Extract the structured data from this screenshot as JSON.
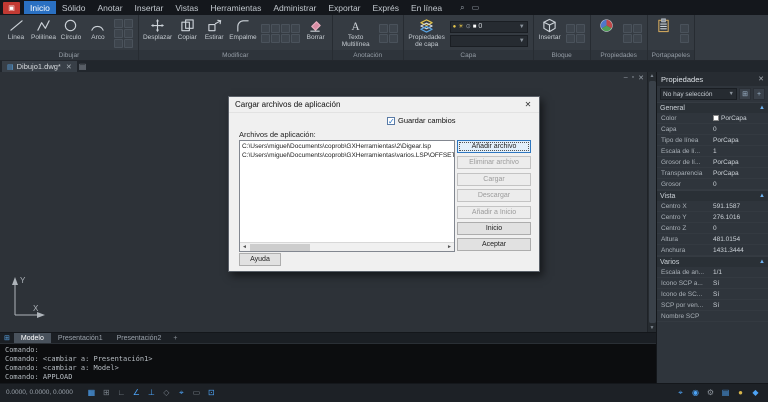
{
  "menubar": {
    "items": [
      "Inicio",
      "Sólido",
      "Anotar",
      "Insertar",
      "Vistas",
      "Herramientas",
      "Administrar",
      "Exportar",
      "Exprés",
      "En línea"
    ],
    "active": "Inicio",
    "quick_icons": [
      {
        "name": "search-icon",
        "glyph": "⌕"
      },
      {
        "name": "window-icon",
        "glyph": "▭"
      }
    ]
  },
  "ribbon": {
    "groups": [
      {
        "id": "dibujar",
        "label": "Dibujar",
        "items": [
          {
            "kind": "tool",
            "id": "linea",
            "label": "Línea",
            "icon": "line"
          },
          {
            "kind": "tool",
            "id": "polilinea",
            "label": "Polilínea",
            "icon": "polyline"
          },
          {
            "kind": "tool",
            "id": "circulo",
            "label": "Círculo",
            "icon": "circle"
          },
          {
            "kind": "tool",
            "id": "arco",
            "label": "Arco",
            "icon": "arc"
          },
          {
            "kind": "minis",
            "count": 6,
            "cols": 2
          }
        ]
      },
      {
        "id": "modificar",
        "label": "Modificar",
        "items": [
          {
            "kind": "tool",
            "id": "desplazar",
            "label": "Desplazar",
            "icon": "move"
          },
          {
            "kind": "tool",
            "id": "copiar",
            "label": "Copiar",
            "icon": "copy"
          },
          {
            "kind": "tool",
            "id": "estirar",
            "label": "Estirar",
            "icon": "stretch"
          },
          {
            "kind": "tool",
            "id": "empalme",
            "label": "Empalme",
            "icon": "fillet"
          },
          {
            "kind": "minis",
            "count": 8,
            "cols": 4
          },
          {
            "kind": "tool",
            "id": "borrar",
            "label": "Borrar",
            "icon": "erase"
          }
        ]
      },
      {
        "id": "anotacion",
        "label": "Anotación",
        "items": [
          {
            "kind": "tool",
            "id": "texto-multilinea",
            "label": "Texto Multilínea",
            "icon": "mtext"
          },
          {
            "kind": "minis",
            "count": 4,
            "cols": 2
          }
        ]
      },
      {
        "id": "capa",
        "label": "Capa",
        "items": [
          {
            "kind": "tool",
            "id": "propiedades-de-capa",
            "label": "Propiedades de capa",
            "icon": "layers"
          },
          {
            "kind": "layerbox"
          }
        ]
      },
      {
        "id": "bloque",
        "label": "Bloque",
        "items": [
          {
            "kind": "tool",
            "id": "insertar",
            "label": "Insertar",
            "icon": "insert"
          },
          {
            "kind": "minis",
            "count": 4,
            "cols": 2
          }
        ]
      },
      {
        "id": "propiedades",
        "label": "Propiedades",
        "items": [
          {
            "kind": "tool",
            "id": "propiedades-objeto",
            "label": "",
            "icon": "propwheel"
          },
          {
            "kind": "minis",
            "count": 4,
            "cols": 2
          }
        ]
      },
      {
        "id": "portapapeles",
        "label": "Portapapeles",
        "items": [
          {
            "kind": "tool",
            "id": "pegar",
            "label": "",
            "icon": "clipboard"
          },
          {
            "kind": "minis",
            "count": 2,
            "cols": 1
          }
        ]
      }
    ],
    "layerbox": {
      "selected_layer": "0",
      "layer_icons": [
        {
          "name": "bulb-icon",
          "glyph": "●",
          "color": "#e6c64c"
        },
        {
          "name": "sun-icon",
          "glyph": "☀",
          "color": "#e6c64c"
        },
        {
          "name": "lock-icon",
          "glyph": "⊙",
          "color": "#9aa2ab"
        },
        {
          "name": "layer-color-swatch",
          "glyph": "■",
          "color": "#ffffff"
        }
      ]
    }
  },
  "docbar": {
    "tab_label": "Dibujo1.dwg*",
    "tab_icon": "▤",
    "close_glyph": "✕",
    "new_tab_glyph": "▤"
  },
  "canvas": {
    "window_controls": [
      {
        "name": "minimize-icon",
        "glyph": "–"
      },
      {
        "name": "restore-icon",
        "glyph": "▫"
      },
      {
        "name": "close-icon",
        "glyph": "✕"
      }
    ],
    "ucs_x_label": "X",
    "ucs_y_label": "Y"
  },
  "dialog": {
    "title": "Cargar archivos de aplicación",
    "close_glyph": "✕",
    "save_changes_label": "Guardar cambios",
    "save_changes_checked": true,
    "files_label": "Archivos de aplicación:",
    "files": [
      "C:\\Users\\miguel\\Documents\\coprob\\GXHerramientas\\2\\Digear.lsp",
      "C:\\Users\\miguel\\Documents\\coprob\\GXHerramientas\\varios.LSP\\OFFSET.LSP"
    ],
    "buttons": [
      {
        "label": "Añadir archivo",
        "disabled": false,
        "focused": true
      },
      {
        "label": "Eliminar archivo",
        "disabled": true,
        "focused": false
      },
      {
        "label": "Cargar",
        "disabled": true,
        "focused": false
      },
      {
        "label": "Descargar",
        "disabled": true,
        "focused": false
      },
      {
        "label": "Añadir a Inicio",
        "disabled": true,
        "focused": false
      },
      {
        "label": "Inicio",
        "disabled": false,
        "focused": false
      },
      {
        "label": "Aceptar",
        "disabled": false,
        "focused": false
      }
    ],
    "help_label": "Ayuda"
  },
  "properties": {
    "title": "Propiedades",
    "close_glyph": "✕",
    "selection": "No hay selección",
    "tool_icons": [
      {
        "name": "toggle-value-icon",
        "glyph": "⊞"
      },
      {
        "name": "quick-select-icon",
        "glyph": "+"
      }
    ],
    "sections": [
      {
        "name": "General",
        "rows": [
          {
            "label": "Color",
            "value": "PorCapa",
            "swatch": "#ffffff"
          },
          {
            "label": "Capa",
            "value": "0"
          },
          {
            "label": "Tipo de línea",
            "value": "PorCapa"
          },
          {
            "label": "Escala de lí...",
            "value": "1"
          },
          {
            "label": "Grosor de lí...",
            "value": "PorCapa"
          },
          {
            "label": "Transparencia",
            "value": "PorCapa"
          },
          {
            "label": "Grosor",
            "value": "0"
          }
        ]
      },
      {
        "name": "Vista",
        "rows": [
          {
            "label": "Centro X",
            "value": "591.1587"
          },
          {
            "label": "Centro Y",
            "value": "276.1016"
          },
          {
            "label": "Centro Z",
            "value": "0"
          },
          {
            "label": "Altura",
            "value": "481.0154"
          },
          {
            "label": "Anchura",
            "value": "1431.3444"
          }
        ]
      },
      {
        "name": "Varios",
        "rows": [
          {
            "label": "Escala de an...",
            "value": "1/1"
          },
          {
            "label": "Icono SCP a...",
            "value": "Sí"
          },
          {
            "label": "Icono de SC...",
            "value": "Sí"
          },
          {
            "label": "SCP por ven...",
            "value": "Sí"
          },
          {
            "label": "Nombre SCP",
            "value": ""
          }
        ]
      }
    ]
  },
  "layouts": {
    "tabs": [
      "Modelo",
      "Presentación1",
      "Presentación2"
    ],
    "active": "Modelo",
    "grid_icon": "⊞",
    "plus_glyph": "+"
  },
  "command": {
    "lines": [
      "Comando:",
      "Comando: <cambiar a: Presentación1>",
      "Comando: <cambiar a: Model>",
      "Comando: APPLOAD"
    ]
  },
  "statusbar": {
    "coords": "0.0000, 0.0000, 0.0000",
    "left_icons": [
      {
        "name": "grid-icon",
        "glyph": "▦",
        "on": true
      },
      {
        "name": "snap-icon",
        "glyph": "⊞",
        "on": false
      },
      {
        "name": "ortho-icon",
        "glyph": "∟",
        "on": false
      },
      {
        "name": "polar-icon",
        "glyph": "∠",
        "on": true
      },
      {
        "name": "osnap-icon",
        "glyph": "⊥",
        "on": true
      },
      {
        "name": "otrack-icon",
        "glyph": "◇",
        "on": false
      },
      {
        "name": "dyn-input-icon",
        "glyph": "⌖",
        "on": true
      },
      {
        "name": "lineweight-icon",
        "glyph": "▭",
        "on": false
      },
      {
        "name": "transparency-icon",
        "glyph": "⊡",
        "on": true
      }
    ],
    "right_icons": [
      {
        "name": "annotation-scale-icon",
        "glyph": "⌖",
        "color": "#4da3f5"
      },
      {
        "name": "workspace-icon",
        "glyph": "◉",
        "color": "#4da3f5"
      },
      {
        "name": "settings-gear-icon",
        "glyph": "⚙",
        "color": "#8b929a"
      },
      {
        "name": "viewport-icon",
        "glyph": "▤",
        "color": "#4da3f5"
      },
      {
        "name": "isolate-objects-icon",
        "glyph": "●",
        "color": "#d8b54a"
      },
      {
        "name": "clean-screen-icon",
        "glyph": "◆",
        "color": "#4da3f5"
      }
    ]
  }
}
